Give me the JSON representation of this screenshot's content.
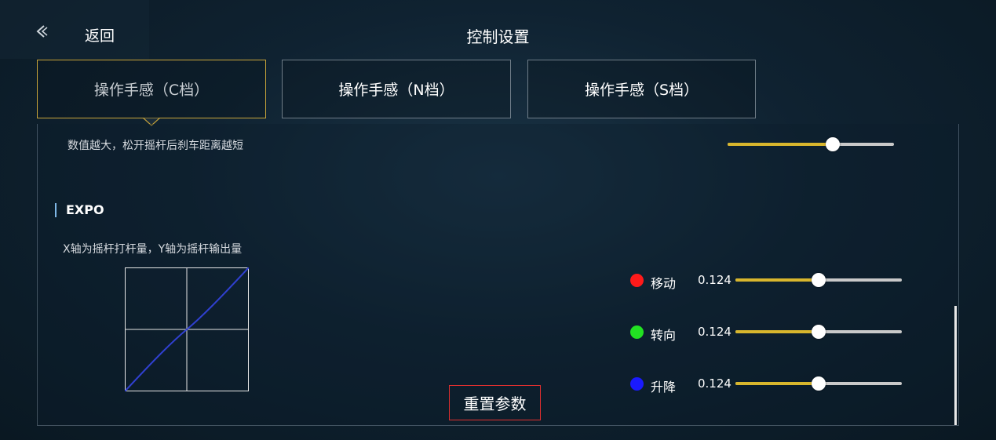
{
  "header": {
    "back_label": "返回",
    "title": "控制设置"
  },
  "tabs": [
    {
      "label": "操作手感（C档）",
      "active": true
    },
    {
      "label": "操作手感（N档）",
      "active": false
    },
    {
      "label": "操作手感（S档）",
      "active": false
    }
  ],
  "brake": {
    "description": "数值越大，松开摇杆后刹车距离越短",
    "level": 0.63
  },
  "expo": {
    "title": "EXPO",
    "description": "X轴为摇杆打杆量，Y轴为摇杆输出量",
    "channels": [
      {
        "label": "移动",
        "value": "0.124",
        "level": 0.5,
        "color": "#ff1a1a"
      },
      {
        "label": "转向",
        "value": "0.124",
        "level": 0.5,
        "color": "#22e222"
      },
      {
        "label": "升降",
        "value": "0.124",
        "level": 0.5,
        "color": "#1a1aff"
      }
    ]
  },
  "reset_label": "重置参数",
  "colors": {
    "accent": "#d8b62d",
    "active_border": "#c9a53a",
    "reset_border": "#e02f2f",
    "curve": "#3040d0"
  }
}
